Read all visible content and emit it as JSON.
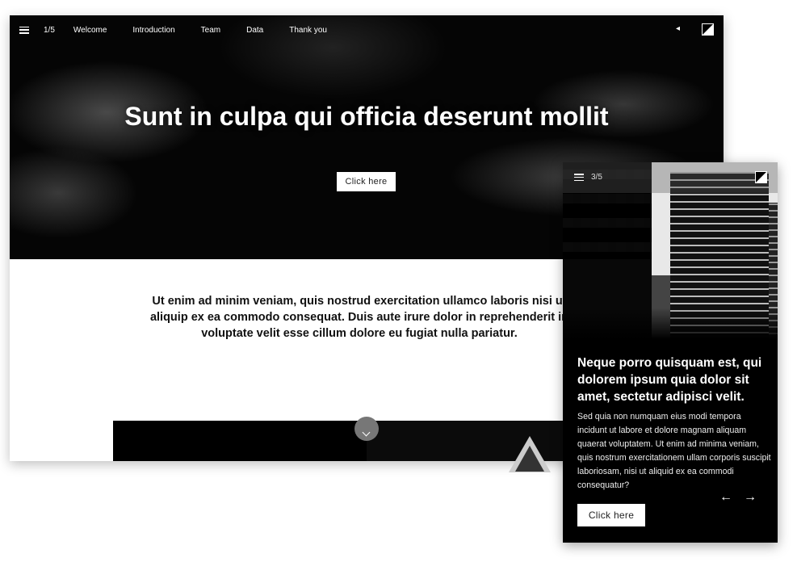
{
  "desktop": {
    "nav": {
      "counter": "1/5",
      "links": [
        "Welcome",
        "Introduction",
        "Team",
        "Data",
        "Thank you"
      ]
    },
    "hero": {
      "title": "Sunt in culpa qui officia deserunt mollit",
      "button": "Click here"
    },
    "body_text": "Ut enim ad minim veniam, quis nostrud exercitation ullamco laboris nisi ut aliquip ex ea commodo consequat. Duis aute irure dolor in reprehenderit in voluptate velit esse cillum dolore eu fugiat nulla pariatur.",
    "icons": [
      "menu-icon",
      "speaker-icon",
      "contrast-icon",
      "chevron-down-icon"
    ]
  },
  "mobile": {
    "counter": "3/5",
    "title": "Neque porro quisquam est, qui dolorem ipsum quia dolor sit amet, sectetur adipisci velit.",
    "text": "Sed quia non numquam eius modi tempora incidunt ut labore et dolore magnam aliquam quaerat voluptatem. Ut enim ad minima veniam, quis nostrum exercitationem ullam corporis suscipit laboriosam, nisi ut aliquid ex ea commodi consequatur?",
    "button": "Click here",
    "prev_arrow": "←",
    "next_arrow": "→"
  }
}
